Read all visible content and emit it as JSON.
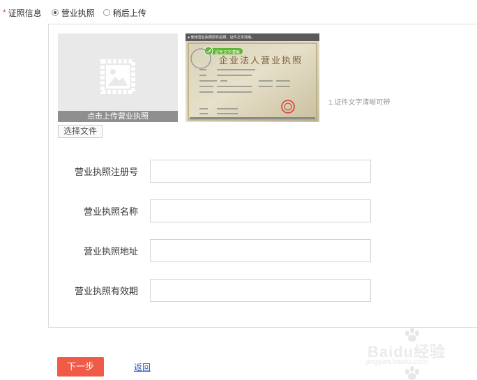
{
  "cert": {
    "required_mark": "*",
    "label": "证照信息",
    "options": [
      {
        "label": "营业执照",
        "checked": true
      },
      {
        "label": "稍后上传",
        "checked": false
      }
    ]
  },
  "upload": {
    "caption": "点击上传营业执照",
    "choose_button": "选择文件"
  },
  "sample": {
    "tip_bar": "● 使用营业执照原件拍照，证件文字清晰。",
    "badge": "证件文字清晰",
    "heading": "企业法人营业执照",
    "note": "1.证件文字清晰可辨"
  },
  "form": {
    "fields": [
      {
        "label": "营业执照注册号",
        "value": ""
      },
      {
        "label": "营业执照名称",
        "value": ""
      },
      {
        "label": "营业执照地址",
        "value": ""
      },
      {
        "label": "营业执照有效期",
        "value": ""
      }
    ]
  },
  "actions": {
    "next_label": "下一步",
    "back_label": "返回"
  },
  "watermark": {
    "brand": "Baidu经验",
    "url": "jingyan.baidu.com"
  },
  "colors": {
    "primary_button": "#f15a47",
    "link": "#2a55c6",
    "required": "#e4393c"
  }
}
